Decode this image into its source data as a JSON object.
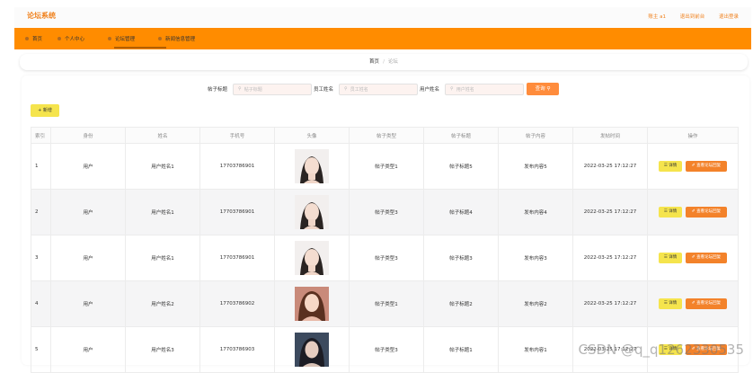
{
  "header": {
    "brand": "论坛系统",
    "user": "账主 a1",
    "to_admin": "退出到前台",
    "logout": "退出登录"
  },
  "nav": [
    {
      "label": "首页"
    },
    {
      "label": "个人中心"
    },
    {
      "label": "论坛管理"
    },
    {
      "label": "新闻信息管理"
    }
  ],
  "breadcrumb": {
    "home": "首页",
    "sep": "/",
    "current": "论坛"
  },
  "search": {
    "title_label": "帖子标题",
    "title_placeholder": "帖子标题",
    "staff_label": "员工姓名",
    "staff_placeholder": "员工姓名",
    "user_label": "用户姓名",
    "user_placeholder": "用户姓名",
    "query_button": "查询"
  },
  "toolbar": {
    "add_button": "+ 新增"
  },
  "table": {
    "columns": [
      "索引",
      "身份",
      "姓名",
      "手机号",
      "头像",
      "帖子类型",
      "帖子标题",
      "帖子内容",
      "发帖时间",
      "操作"
    ],
    "rows": [
      {
        "index": "1",
        "role": "用户",
        "name": "用户姓名1",
        "phone": "17703786901",
        "avatar": "avatar-a",
        "type": "帖子类型1",
        "title": "帖子标题5",
        "content": "发布内容5",
        "time": "2022-03-25 17:12:27"
      },
      {
        "index": "2",
        "role": "用户",
        "name": "用户姓名1",
        "phone": "17703786901",
        "avatar": "avatar-a",
        "type": "帖子类型3",
        "title": "帖子标题4",
        "content": "发布内容4",
        "time": "2022-03-25 17:12:27"
      },
      {
        "index": "3",
        "role": "用户",
        "name": "用户姓名1",
        "phone": "17703786901",
        "avatar": "avatar-a",
        "type": "帖子类型3",
        "title": "帖子标题3",
        "content": "发布内容3",
        "time": "2022-03-25 17:12:27"
      },
      {
        "index": "4",
        "role": "用户",
        "name": "用户姓名2",
        "phone": "17703786902",
        "avatar": "avatar-b",
        "type": "帖子类型1",
        "title": "帖子标题2",
        "content": "发布内容2",
        "time": "2022-03-25 17:12:27"
      },
      {
        "index": "5",
        "role": "用户",
        "name": "用户姓名3",
        "phone": "17703786903",
        "avatar": "avatar-c",
        "type": "帖子类型3",
        "title": "帖子标题1",
        "content": "发布内容1",
        "time": "2022-03-25 17:12:27"
      }
    ],
    "detail_button": "☰ 详情",
    "reply_button": "✐ 查看论坛回复"
  },
  "watermark": "CSDN @q_q1262330535",
  "colors": {
    "accent": "#ff8c00",
    "brand_text": "#f0821e",
    "detail_btn": "#f5e44d",
    "reply_btn": "#f3822a"
  }
}
